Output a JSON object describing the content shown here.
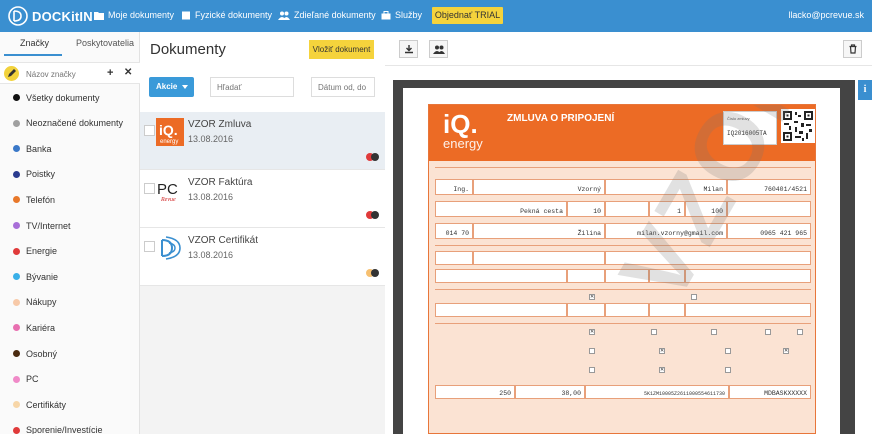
{
  "topbar": {
    "brand": "DOCKitIN",
    "nav": [
      {
        "label": "Moje dokumenty",
        "icon": "folder-icon"
      },
      {
        "label": "Fyzické dokumenty",
        "icon": "box-icon"
      },
      {
        "label": "Zdieľané dokumenty",
        "icon": "users-icon"
      },
      {
        "label": "Služby",
        "icon": "briefcase-icon"
      }
    ],
    "trial_label": "Objednať TRIAL",
    "user_email": "llacko@pcrevue.sk",
    "bar_color": "#3a8fd0",
    "accent_color": "#f5d33c"
  },
  "sidebar": {
    "tabs": [
      "Značky",
      "Poskytovatelia"
    ],
    "tag_search_placeholder": "Názov značky",
    "tags": [
      {
        "label": "Všetky dokumenty",
        "color": "#111111"
      },
      {
        "label": "Neoznačené dokumenty",
        "color": "#a0a0a0"
      },
      {
        "label": "Banka",
        "color": "#3a78c8"
      },
      {
        "label": "Poistky",
        "color": "#2a3b8f"
      },
      {
        "label": "Telefón",
        "color": "#e8782a"
      },
      {
        "label": "TV/Internet",
        "color": "#a86fd8"
      },
      {
        "label": "Energie",
        "color": "#e03a3a"
      },
      {
        "label": "Bývanie",
        "color": "#3ab0e8"
      },
      {
        "label": "Nákupy",
        "color": "#f7c9a8"
      },
      {
        "label": "Kariéra",
        "color": "#e86fb0"
      },
      {
        "label": "Osobný",
        "color": "#4a2a10"
      },
      {
        "label": "PC",
        "color": "#f08ac8"
      },
      {
        "label": "Certifikáty",
        "color": "#f7d6a8"
      },
      {
        "label": "Sporenie/Investície",
        "color": "#e03a3a"
      }
    ]
  },
  "documents": {
    "title": "Dokumenty",
    "insert_label": "Vložiť dokument",
    "actions_label": "Akcie",
    "search_placeholder": "Hľadať",
    "date_placeholder": "Dátum od, do",
    "items": [
      {
        "name": "VZOR Zmluva",
        "date": "13.08.2016",
        "tag_colors": [
          "#e03a3a",
          "#333333"
        ]
      },
      {
        "name": "VZOR Faktúra",
        "date": "13.08.2016",
        "tag_colors": [
          "#e03a3a",
          "#333333"
        ]
      },
      {
        "name": "VZOR Certifikát",
        "date": "13.08.2016",
        "tag_colors": [
          "#f7c070",
          "#333333"
        ]
      }
    ]
  },
  "contract": {
    "brand_big": "iQ.",
    "brand_small": "energy",
    "title": "ZMLUVA O PRIPOJENÍ",
    "contract_no_label": "Číslo zmluvy",
    "contract_no": "IQ2016005TA",
    "titul": "Ing.",
    "surname": "Vzorný",
    "name": "Milan",
    "rc": "760401/4521",
    "street": "Pekná cesta",
    "street_no": "10",
    "floor": "1",
    "entrance": "100",
    "psc": "014 70",
    "city": "Žilina",
    "email": "milan.vzorny@gmail.com",
    "phone": "0965 421 965",
    "consumption": "250",
    "deposit": "38,00",
    "eic": "5K1ZM10005Z2611000554611730",
    "ean": "MDBASKXXXXX",
    "watermark": "VZOR"
  }
}
